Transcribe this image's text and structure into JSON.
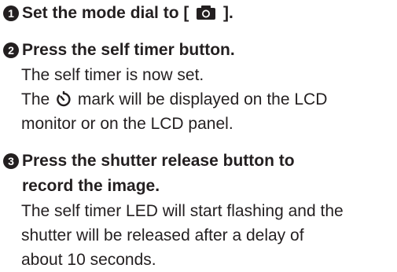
{
  "steps": [
    {
      "number": "1",
      "heading_before": "Set the mode dial to [",
      "heading_icon": "camera-icon",
      "heading_after": "].",
      "description": []
    },
    {
      "number": "2",
      "heading": [
        "Press the self timer button."
      ],
      "description": [
        "The self timer is now set.",
        "The",
        "mark will be displayed on the LCD",
        "monitor or on the LCD panel."
      ],
      "description_icon": "self-timer-icon"
    },
    {
      "number": "3",
      "heading": [
        "Press the shutter release button to",
        "record the image."
      ],
      "description": [
        "The self timer LED will start flashing and the",
        "shutter will be released after a delay of",
        "about 10 seconds."
      ]
    }
  ]
}
